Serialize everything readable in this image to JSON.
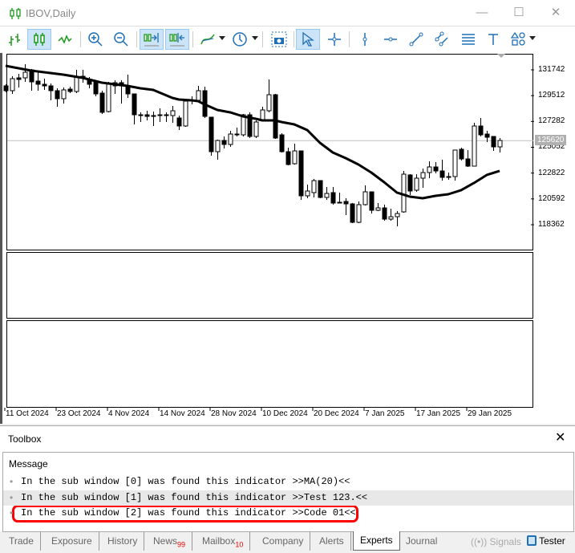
{
  "window": {
    "title": "IBOV,Daily",
    "minimize": "—",
    "maximize": "☐",
    "close": "✕"
  },
  "toolbar": {
    "icons": [
      "bar-chart-icon",
      "candlestick-icon",
      "line-chart-icon",
      "zoom-in-icon",
      "zoom-out-icon",
      "chart-shift-icon",
      "autoscroll-icon",
      "indicators-icon",
      "timeframe-icon",
      "screenshot-icon",
      "cursor-icon",
      "crosshair-icon",
      "vertical-line-icon",
      "horizontal-line-icon",
      "trendline-icon",
      "channel-icon",
      "fibonacci-icon",
      "text-icon",
      "shapes-icon"
    ],
    "active": [
      "candlestick-icon",
      "chart-shift-icon",
      "autoscroll-icon",
      "cursor-icon"
    ]
  },
  "chart_data": {
    "type": "candlestick",
    "symbol": "IBOV",
    "timeframe": "Daily",
    "ylim": [
      117800,
      133100
    ],
    "yticks": [
      "131742",
      "129512",
      "127282",
      "125052",
      "122822",
      "120592",
      "118362"
    ],
    "current_price": "125620",
    "xlabels": [
      {
        "i": 1,
        "t": "11 Oct 2024"
      },
      {
        "i": 9,
        "t": "23 Oct 2024"
      },
      {
        "i": 17,
        "t": "4 Nov 2024"
      },
      {
        "i": 25,
        "t": "14 Nov 2024"
      },
      {
        "i": 33,
        "t": "28 Nov 2024"
      },
      {
        "i": 41,
        "t": "10 Dec 2024"
      },
      {
        "i": 49,
        "t": "20 Dec 2024"
      },
      {
        "i": 57,
        "t": "7 Jan 2025"
      },
      {
        "i": 65,
        "t": "17 Jan 2025"
      },
      {
        "i": 73,
        "t": "29 Jan 2025"
      }
    ],
    "ohlc": [
      [
        130356,
        130494,
        129801,
        129940
      ],
      [
        129940,
        131188,
        129662,
        130980
      ],
      [
        131049,
        131396,
        130217,
        130910
      ],
      [
        131049,
        132228,
        130702,
        131534
      ],
      [
        131742,
        131812,
        129940,
        130702
      ],
      [
        130771,
        131534,
        129940,
        130494
      ],
      [
        130494,
        130980,
        130009,
        130356
      ],
      [
        130356,
        130564,
        129108,
        129940
      ],
      [
        129940,
        130148,
        128553,
        129246
      ],
      [
        129246,
        130217,
        128830,
        130009
      ],
      [
        130078,
        130286,
        129732,
        129870
      ],
      [
        129870,
        131742,
        129732,
        131118
      ],
      [
        131188,
        131742,
        130633,
        131049
      ],
      [
        130910,
        131118,
        130148,
        130494
      ],
      [
        130702,
        130841,
        129454,
        129662
      ],
      [
        129732,
        129940,
        127929,
        128068
      ],
      [
        128137,
        130702,
        128068,
        130494
      ],
      [
        130356,
        130841,
        129662,
        130633
      ],
      [
        130633,
        130841,
        128830,
        130356
      ],
      [
        130356,
        131327,
        129316,
        129662
      ],
      [
        129662,
        129662,
        127028,
        127860
      ],
      [
        127860,
        128068,
        127236,
        127790
      ],
      [
        127860,
        128206,
        127375,
        127721
      ],
      [
        127721,
        128137,
        126890,
        127790
      ],
      [
        127860,
        128415,
        127236,
        127790
      ],
      [
        127790,
        128068,
        127236,
        127860
      ],
      [
        127790,
        128622,
        127167,
        128206
      ],
      [
        127583,
        127790,
        126543,
        126890
      ],
      [
        126890,
        129177,
        126820,
        129038
      ],
      [
        129108,
        129454,
        128761,
        129038
      ],
      [
        129108,
        130356,
        128969,
        129940
      ],
      [
        129940,
        130286,
        127583,
        127721
      ],
      [
        127652,
        127652,
        124324,
        124671
      ],
      [
        124671,
        125711,
        123978,
        125641
      ],
      [
        125641,
        125988,
        124948,
        125295
      ],
      [
        125295,
        126473,
        125087,
        126196
      ],
      [
        126196,
        126750,
        125988,
        126127
      ],
      [
        126127,
        127929,
        125988,
        127860
      ],
      [
        127860,
        128068,
        125849,
        125988
      ],
      [
        125988,
        127375,
        125849,
        127236
      ],
      [
        127444,
        128553,
        127375,
        128276
      ],
      [
        128206,
        130910,
        128068,
        129593
      ],
      [
        129593,
        129662,
        125780,
        125849
      ],
      [
        126127,
        126266,
        124601,
        124671
      ],
      [
        124671,
        125017,
        123492,
        123562
      ],
      [
        123631,
        125364,
        123562,
        124740
      ],
      [
        124740,
        124740,
        120511,
        120857
      ],
      [
        120857,
        121828,
        120649,
        121274
      ],
      [
        121135,
        122313,
        120719,
        122175
      ],
      [
        122175,
        122175,
        120649,
        120719
      ],
      [
        120719,
        121620,
        120511,
        121066
      ],
      [
        121135,
        121620,
        120095,
        120233
      ],
      [
        120303,
        121135,
        120233,
        120233
      ],
      [
        120372,
        120649,
        119193,
        120164
      ],
      [
        120164,
        120233,
        118500,
        118569
      ],
      [
        118569,
        120372,
        118500,
        120095
      ],
      [
        120095,
        121759,
        120025,
        121204
      ],
      [
        121204,
        121204,
        119332,
        119609
      ],
      [
        119609,
        120233,
        119540,
        119817
      ],
      [
        119817,
        120095,
        118708,
        118847
      ],
      [
        118847,
        119748,
        118708,
        119055
      ],
      [
        119055,
        119540,
        118222,
        119332
      ],
      [
        119471,
        123007,
        119401,
        122730
      ],
      [
        122661,
        122730,
        120927,
        121274
      ],
      [
        121343,
        122730,
        121204,
        122383
      ],
      [
        122383,
        123215,
        121551,
        122868
      ],
      [
        122868,
        123839,
        122383,
        123353
      ],
      [
        123353,
        123770,
        122799,
        123007
      ],
      [
        123007,
        123978,
        122175,
        122452
      ],
      [
        122521,
        122868,
        122244,
        122521
      ],
      [
        122521,
        124810,
        122175,
        124810
      ],
      [
        124879,
        125017,
        123908,
        124047
      ],
      [
        124047,
        124810,
        123353,
        123423
      ],
      [
        123423,
        127167,
        123423,
        126890
      ],
      [
        126890,
        127583,
        125988,
        126127
      ],
      [
        126196,
        126473,
        125502,
        125919
      ],
      [
        125988,
        125988,
        124740,
        125087
      ],
      [
        125087,
        125849,
        124601,
        125641
      ]
    ],
    "ma": {
      "name": "MA(20)",
      "points": [
        [
          1,
          132090
        ],
        [
          5,
          131673
        ],
        [
          7,
          131534
        ],
        [
          10,
          131327
        ],
        [
          13,
          131049
        ],
        [
          16,
          130633
        ],
        [
          18,
          130494
        ],
        [
          20,
          130356
        ],
        [
          22,
          130148
        ],
        [
          24,
          130009
        ],
        [
          27,
          129316
        ],
        [
          28,
          129177
        ],
        [
          30,
          129108
        ],
        [
          31,
          129038
        ],
        [
          32,
          128761
        ],
        [
          34,
          128276
        ],
        [
          36,
          128068
        ],
        [
          38,
          127721
        ],
        [
          40,
          127513
        ],
        [
          41,
          127375
        ],
        [
          43,
          127375
        ],
        [
          44,
          127236
        ],
        [
          46,
          127028
        ],
        [
          48,
          126543
        ],
        [
          50,
          125433
        ],
        [
          52,
          124601
        ],
        [
          54,
          124116
        ],
        [
          56,
          123562
        ],
        [
          58,
          122868
        ],
        [
          60,
          122036
        ],
        [
          62,
          121135
        ],
        [
          64,
          120788
        ],
        [
          66,
          120649
        ],
        [
          68,
          120857
        ],
        [
          70,
          120996
        ],
        [
          72,
          121343
        ],
        [
          74,
          121967
        ],
        [
          75,
          122313
        ],
        [
          76,
          122661
        ],
        [
          78,
          123007
        ]
      ]
    },
    "colors": {
      "bull_body": "#ffffff",
      "bear_body": "#000000",
      "ma": "#000000",
      "price_line": "#c0c0c0"
    }
  },
  "toolbox": {
    "title": "Toolbox",
    "close": "✕",
    "column": "Message",
    "messages": [
      "In the sub window [0] was found this indicator >>MA(20)<<",
      "In the sub window [1] was found this indicator >>Test 123.<<",
      "In the sub window [2] was found this indicator >>Code 01<<"
    ],
    "tabs": [
      {
        "label": "Trade"
      },
      {
        "label": "Exposure"
      },
      {
        "label": "History"
      },
      {
        "label": "News",
        "badge": "99"
      },
      {
        "label": "Mailbox",
        "badge": "10"
      },
      {
        "label": "Company"
      },
      {
        "label": "Alerts"
      },
      {
        "label": "Experts"
      },
      {
        "label": "Journal"
      }
    ],
    "active_tab": "Experts",
    "signals": "Signals",
    "tester": "Tester",
    "highlight_color": "#ff0000"
  }
}
